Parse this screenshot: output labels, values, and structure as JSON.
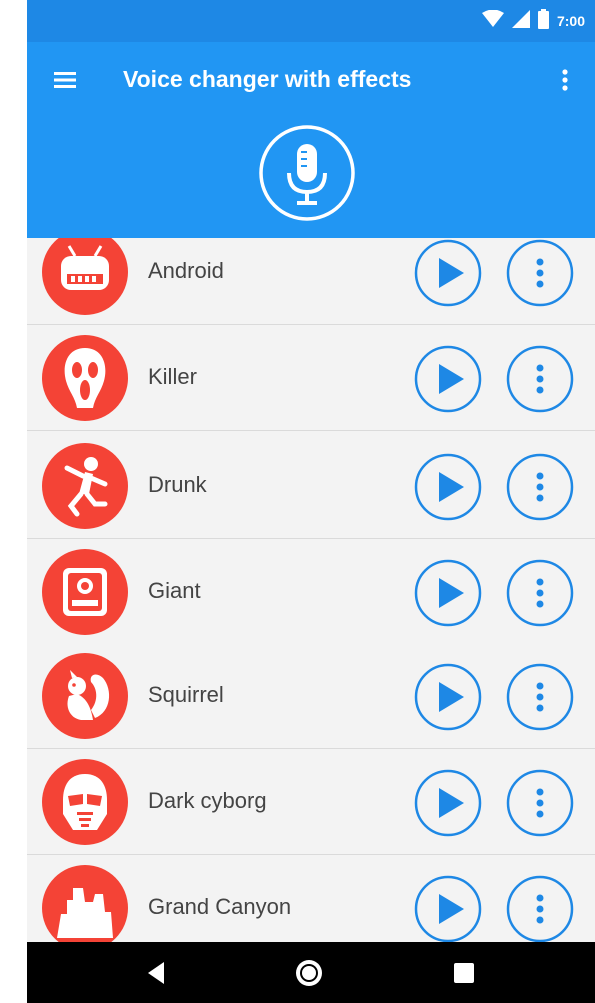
{
  "status_bar": {
    "time": "7:00"
  },
  "toolbar": {
    "title": "Voice changer with effects",
    "menu_icon": "hamburger-icon",
    "more_icon": "more-vert-icon",
    "mic_icon": "microphone-icon"
  },
  "colors": {
    "primary": "#2196f3",
    "status_bar": "#1e88e5",
    "accent_red": "#f44336",
    "action_blue": "#1e88e5",
    "background": "#f3f3f3"
  },
  "effects": [
    {
      "label": "Android",
      "icon": "robot-icon"
    },
    {
      "label": "Killer",
      "icon": "ghostface-mask-icon"
    },
    {
      "label": "Drunk",
      "icon": "dancing-figure-icon"
    },
    {
      "label": "Giant",
      "icon": "giant-icon"
    },
    {
      "label": "Squirrel",
      "icon": "squirrel-icon"
    },
    {
      "label": "Dark cyborg",
      "icon": "cyborg-helmet-icon"
    },
    {
      "label": "Grand Canyon",
      "icon": "canyon-icon"
    }
  ],
  "nav_bar": {
    "back_icon": "back-triangle-icon",
    "home_icon": "home-circle-icon",
    "recent_icon": "recent-apps-square-icon"
  }
}
